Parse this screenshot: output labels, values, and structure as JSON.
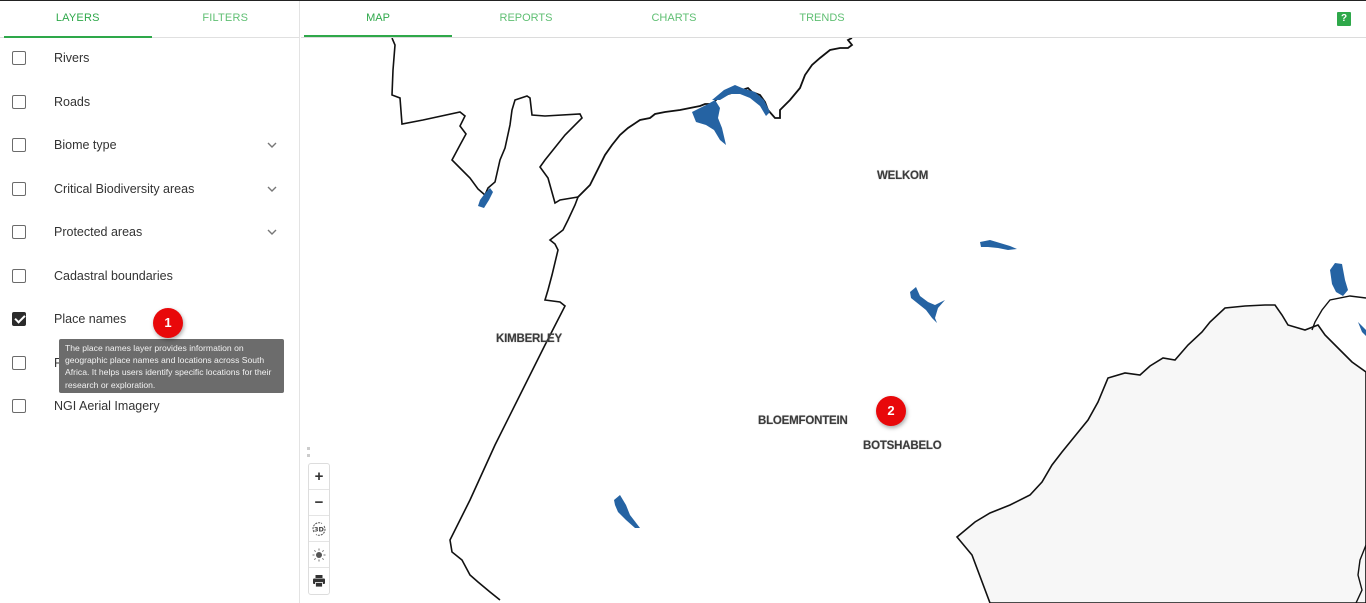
{
  "sidebar": {
    "tabs": [
      {
        "label": "LAYERS",
        "active": true
      },
      {
        "label": "FILTERS",
        "active": false
      }
    ],
    "layers": [
      {
        "label": "Rivers",
        "checked": false,
        "expandable": false
      },
      {
        "label": "Roads",
        "checked": false,
        "expandable": false
      },
      {
        "label": "Biome type",
        "checked": false,
        "expandable": true
      },
      {
        "label": "Critical Biodiversity areas",
        "checked": false,
        "expandable": true
      },
      {
        "label": "Protected areas",
        "checked": false,
        "expandable": true
      },
      {
        "label": "Cadastral boundaries",
        "checked": false,
        "expandable": false
      },
      {
        "label": "Place names",
        "checked": true,
        "expandable": false
      },
      {
        "label": "Properties",
        "checked": false,
        "expandable": false
      },
      {
        "label": "NGI Aerial Imagery",
        "checked": false,
        "expandable": false
      }
    ],
    "tooltip": "The place names layer provides information on geographic place names and locations across South Africa. It helps users identify specific locations for their research or exploration."
  },
  "badges": [
    {
      "label": "1"
    },
    {
      "label": "2"
    }
  ],
  "main_tabs": [
    {
      "label": "MAP",
      "active": true
    },
    {
      "label": "REPORTS",
      "active": false
    },
    {
      "label": "CHARTS",
      "active": false
    },
    {
      "label": "TRENDS",
      "active": false
    }
  ],
  "help": {
    "label": "?"
  },
  "map": {
    "places": [
      {
        "name": "WELKOM"
      },
      {
        "name": "KIMBERLEY"
      },
      {
        "name": "BLOEMFONTEIN"
      },
      {
        "name": "BOTSHABELO"
      }
    ],
    "controls": {
      "zoom_in": "+",
      "zoom_out": "−",
      "toggle_3d": "3D"
    },
    "colors": {
      "water": "#2563a3",
      "boundary": "#111111",
      "lesotho_fill": "#f7f7f7",
      "accent": "#2ea84a",
      "badge": "#e8080a"
    }
  }
}
